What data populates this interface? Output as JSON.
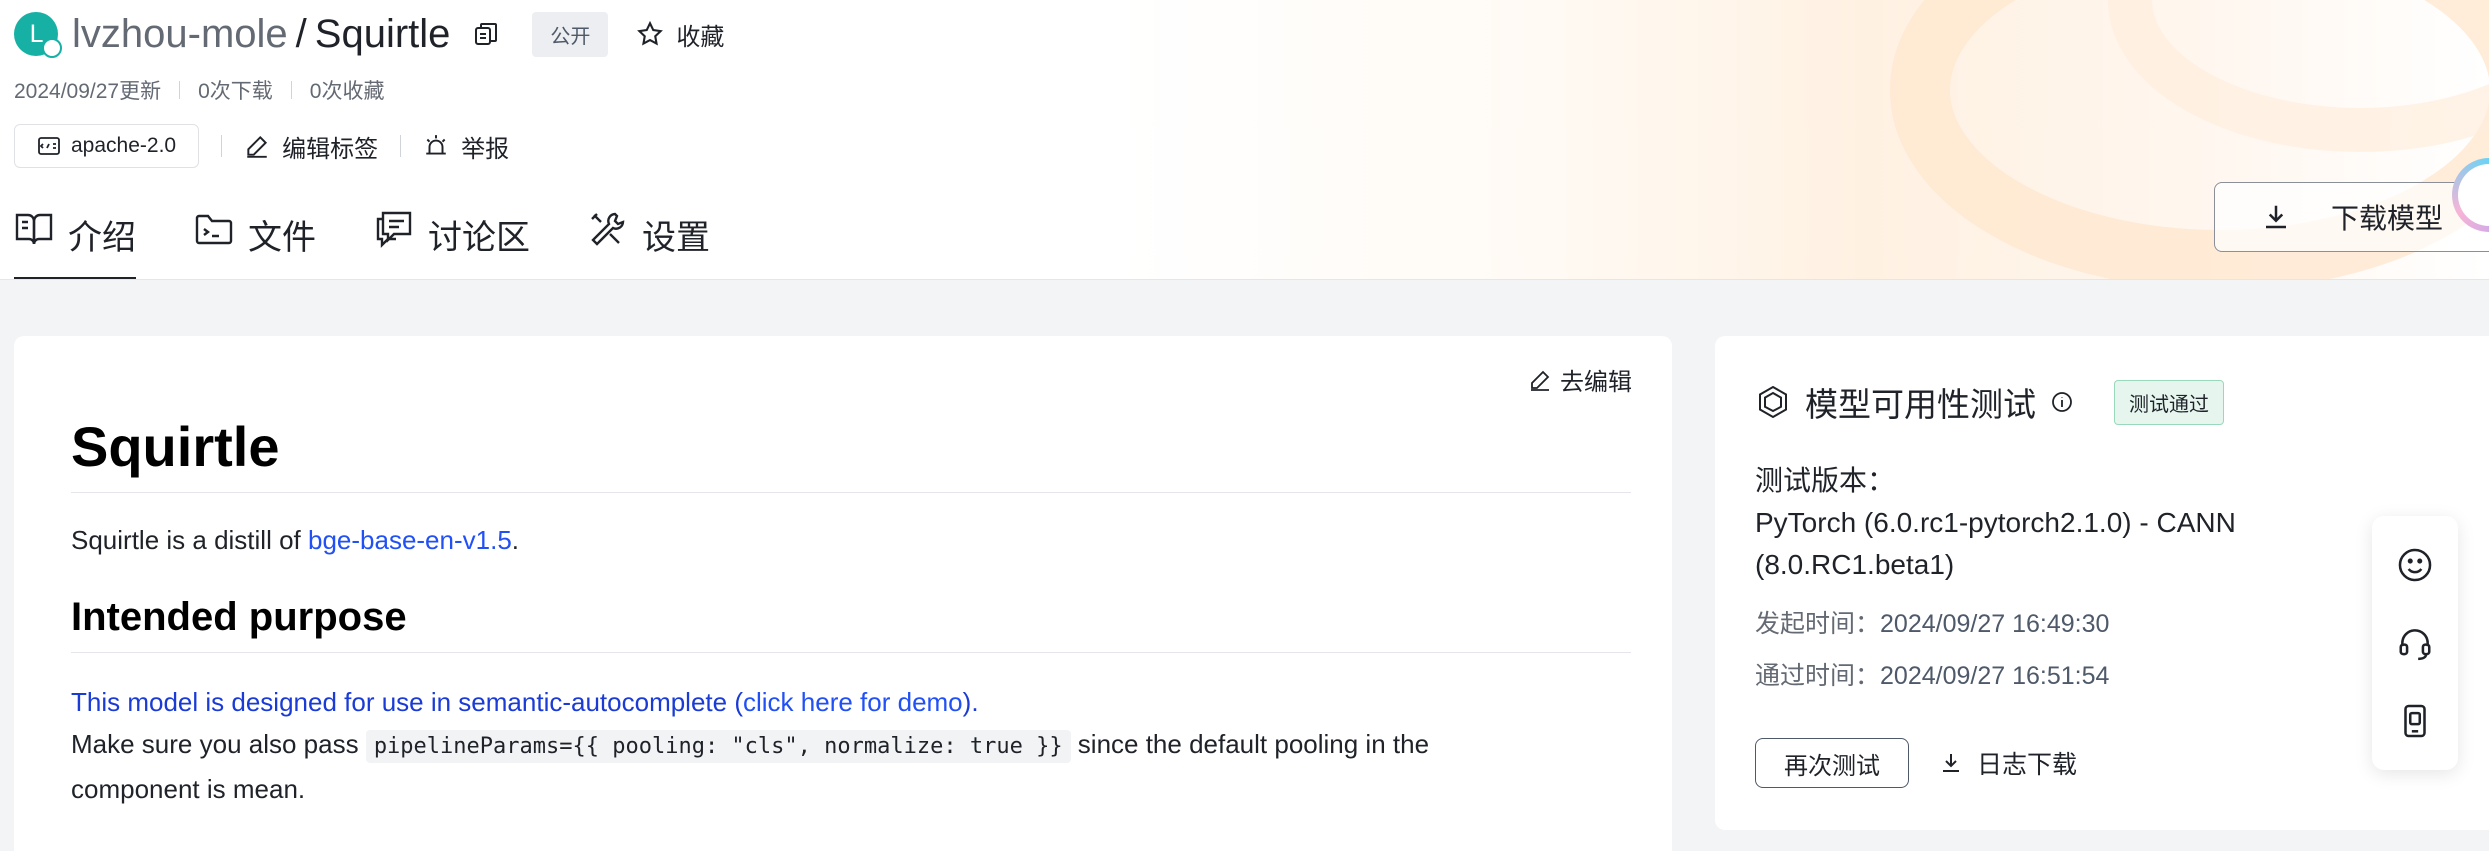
{
  "repo": {
    "avatar_letter": "L",
    "owner": "lvzhou-mole",
    "separator": "/",
    "name": "Squirtle",
    "visibility": "公开",
    "favorite_label": "收藏"
  },
  "meta": {
    "updated": "2024/09/27更新",
    "downloads": "0次下载",
    "favorites": "0次收藏"
  },
  "tags": {
    "license": "apache-2.0",
    "edit_tags": "编辑标签",
    "report": "举报"
  },
  "tabs": [
    {
      "label": "介绍",
      "icon": "book-icon",
      "active": true
    },
    {
      "label": "文件",
      "icon": "folder-icon",
      "active": false
    },
    {
      "label": "讨论区",
      "icon": "chat-icon",
      "active": false
    },
    {
      "label": "设置",
      "icon": "tools-icon",
      "active": false
    }
  ],
  "download_button": "下载模型",
  "readme": {
    "edit_label": "去编辑",
    "h1": "Squirtle",
    "p1_prefix": "Squirtle is a distill of ",
    "p1_link": "bge-base-en-v1.5",
    "p1_suffix": ".",
    "h2": "Intended purpose",
    "p2_text": "This model is designed for use in semantic-autocomplete (",
    "p2_link": "click here for demo",
    "p2_close": ").",
    "p3_prefix": "Make sure you also pass ",
    "p3_code": "pipelineParams={{ pooling: \"cls\", normalize: true }}",
    "p3_suffix": " since the default pooling in the",
    "p4": "component is mean."
  },
  "availability": {
    "title": "模型可用性测试",
    "status": "测试通过",
    "version_label": "测试版本：",
    "version_value": "PyTorch (6.0.rc1-pytorch2.1.0) - CANN (8.0.RC1.beta1)",
    "start_label": "发起时间：",
    "start_value": "2024/09/27 16:49:30",
    "pass_label": "通过时间：",
    "pass_value": "2024/09/27 16:51:54",
    "retest_button": "再次测试",
    "log_download": "日志下载"
  },
  "colors": {
    "avatar": "#16b1a4",
    "link": "#2150f5",
    "pass_badge_bg": "#e6f6ef"
  }
}
